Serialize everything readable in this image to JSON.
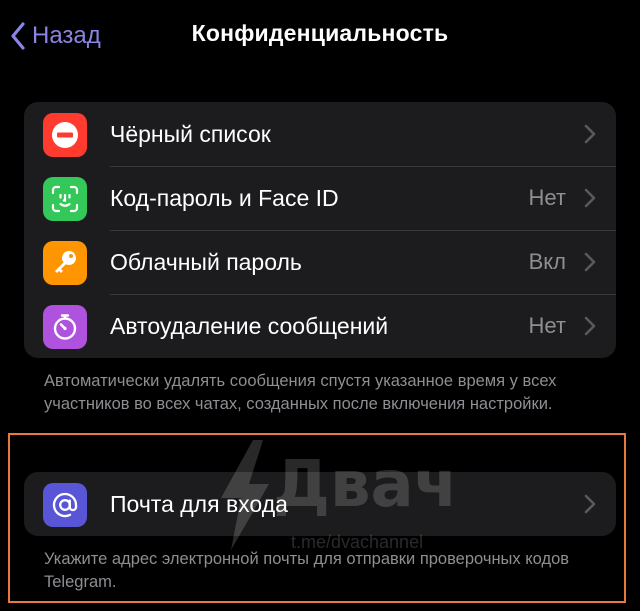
{
  "navbar": {
    "back_label": "Назад",
    "title": "Конфиденциальность"
  },
  "privacy_group": {
    "items": [
      {
        "label": "Чёрный список",
        "value": "",
        "icon": "blocked-icon",
        "color": "#ff3b30"
      },
      {
        "label": "Код-пароль и Face ID",
        "value": "Нет",
        "icon": "face-id-icon",
        "color": "#34c759"
      },
      {
        "label": "Облачный пароль",
        "value": "Вкл",
        "icon": "key-icon",
        "color": "#ff9500"
      },
      {
        "label": "Автоудаление сообщений",
        "value": "Нет",
        "icon": "timer-icon",
        "color": "#af52de"
      }
    ],
    "footer": "Автоматически удалять сообщения спустя указанное время у всех участников во всех чатах, созданных после включения настройки."
  },
  "email_group": {
    "items": [
      {
        "label": "Почта для входа",
        "value": "",
        "icon": "at-sign-icon",
        "color": "#5856d6"
      }
    ],
    "footer": "Укажите адрес электронной почты для отправки проверочных кодов Telegram."
  },
  "watermark": {
    "brand": "Двач",
    "link": "t.me/dvachannel"
  },
  "colors": {
    "accent": "#8a84e6",
    "highlight": "#e8783c",
    "secondary_text": "#8e8e93",
    "cell_background": "#1c1c1e"
  }
}
